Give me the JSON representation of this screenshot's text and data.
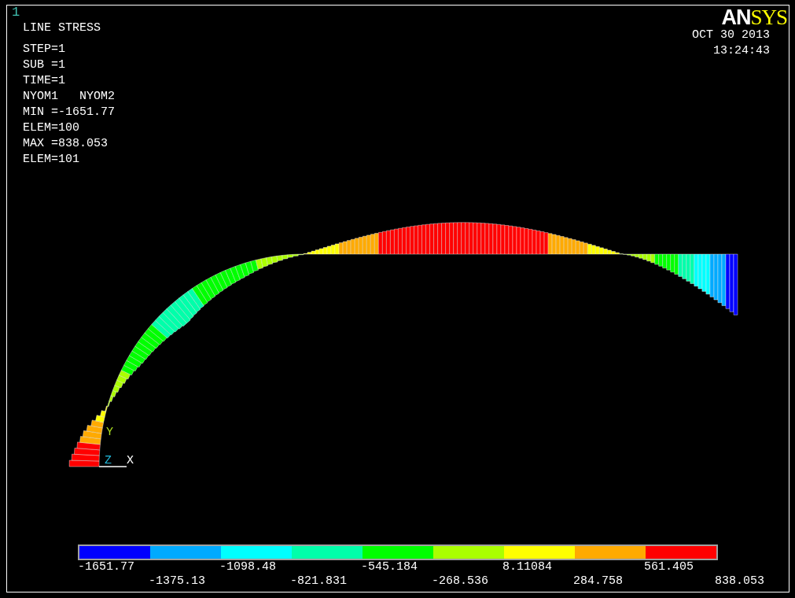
{
  "viewport": {
    "number": "1",
    "title": "LINE STRESS",
    "info": [
      "STEP=1",
      "SUB =1",
      "TIME=1",
      "NYOM1   NYOM2",
      "MIN =-1651.77",
      "ELEM=100",
      "MAX =838.053",
      "ELEM=101"
    ],
    "logo_parts": [
      "AN",
      "SYS"
    ],
    "date": "OCT 30 2013",
    "time": "13:24:43",
    "triad": [
      {
        "label": "Y"
      },
      {
        "label": "Z"
      },
      {
        "label": "X"
      }
    ],
    "legend": {
      "bands": [
        {
          "color": "#0000ff"
        },
        {
          "color": "#00aaff"
        },
        {
          "color": "#00ffff"
        },
        {
          "color": "#00ffaa"
        },
        {
          "color": "#00ff00"
        },
        {
          "color": "#aaff00"
        },
        {
          "color": "#ffff00"
        },
        {
          "color": "#ffaa00"
        },
        {
          "color": "#ff0000"
        }
      ],
      "labels": [
        "-1651.77",
        "-1375.13",
        "-1098.48",
        "-821.831",
        "-545.184",
        "-268.536",
        "8.11084",
        "284.758",
        "561.405",
        "838.053"
      ]
    }
  }
}
